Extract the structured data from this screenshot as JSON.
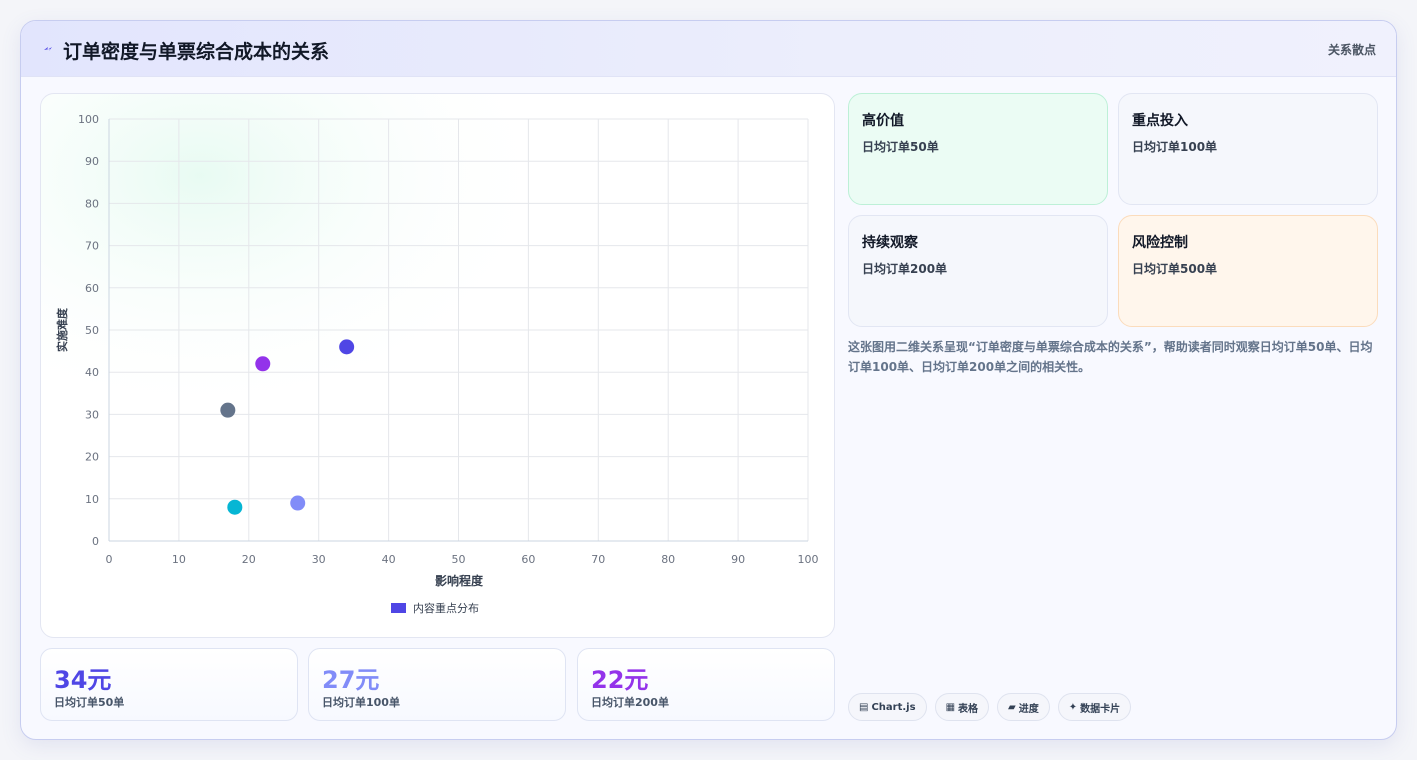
{
  "header": {
    "title": "订单密度与单票综合成本的关系",
    "badge": "关系散点"
  },
  "chart_data": {
    "type": "scatter",
    "title": "",
    "xlabel": "影响程度",
    "ylabel": "实施难度",
    "xlim": [
      0,
      100
    ],
    "ylim": [
      0,
      100
    ],
    "xticks": [
      0,
      10,
      20,
      30,
      40,
      50,
      60,
      70,
      80,
      90,
      100
    ],
    "yticks": [
      0,
      10,
      20,
      30,
      40,
      50,
      60,
      70,
      80,
      90,
      100
    ],
    "grid": true,
    "legend": "bottom",
    "series": [
      {
        "name": "内容重点分布",
        "color": "#4f46e5",
        "points": [
          {
            "x": 34,
            "y": 46,
            "color": "#4f46e5"
          },
          {
            "x": 22,
            "y": 42,
            "color": "#9333ea"
          },
          {
            "x": 17,
            "y": 31,
            "color": "#64748b"
          },
          {
            "x": 27,
            "y": 9,
            "color": "#818cf8"
          },
          {
            "x": 18,
            "y": 8,
            "color": "#06b6d4"
          }
        ]
      }
    ]
  },
  "stats": [
    {
      "value": "34元",
      "label": "日均订单50单",
      "color": "#4f46e5"
    },
    {
      "value": "27元",
      "label": "日均订单100单",
      "color": "#818cf8"
    },
    {
      "value": "22元",
      "label": "日均订单200单",
      "color": "#9333ea"
    }
  ],
  "quadrants": [
    {
      "title": "高价值",
      "sub": "日均订单50单",
      "bg": "#ebfcf4",
      "border": "#bdf0d7"
    },
    {
      "title": "重点投入",
      "sub": "日均订单100单",
      "bg": "#f5f7fc",
      "border": "#e2e6f3"
    },
    {
      "title": "持续观察",
      "sub": "日均订单200单",
      "bg": "#f5f7fc",
      "border": "#e2e6f3"
    },
    {
      "title": "风险控制",
      "sub": "日均订单500单",
      "bg": "#fff6ec",
      "border": "#fbdcbc"
    }
  ],
  "description": "这张图用二维关系呈现“订单密度与单票综合成本的关系”，帮助读者同时观察日均订单50单、日均订单100单、日均订单200单之间的相关性。",
  "tags": [
    {
      "icon": "▤",
      "label": "Chart.js"
    },
    {
      "icon": "▦",
      "label": "表格"
    },
    {
      "icon": "▰",
      "label": "进度"
    },
    {
      "icon": "✦",
      "label": "数据卡片"
    }
  ]
}
